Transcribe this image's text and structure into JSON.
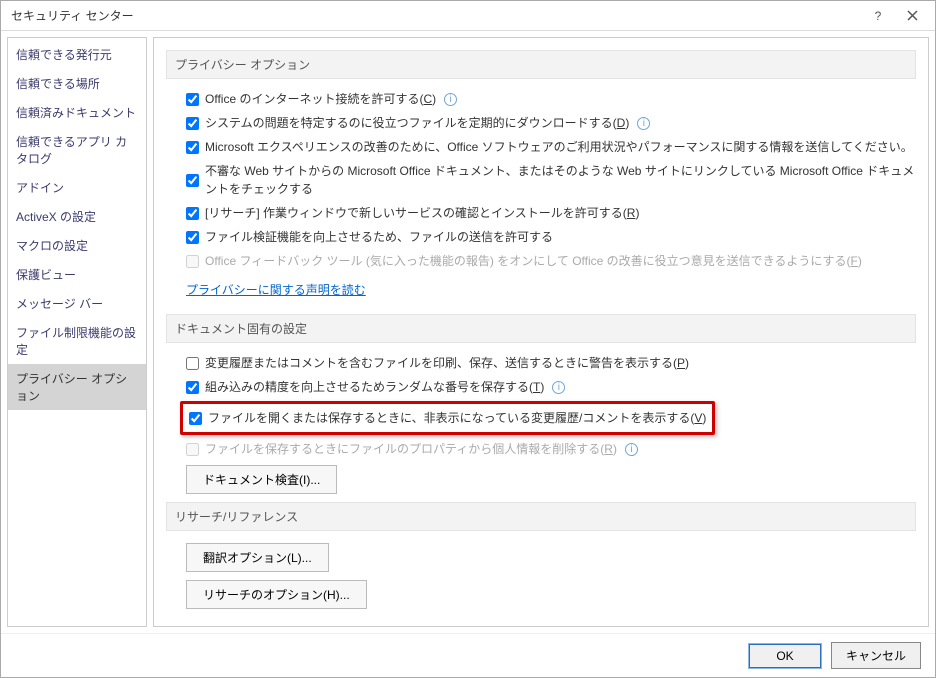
{
  "window": {
    "title": "セキュリティ センター"
  },
  "sidebar": {
    "items": [
      {
        "label": "信頼できる発行元"
      },
      {
        "label": "信頼できる場所"
      },
      {
        "label": "信頼済みドキュメント"
      },
      {
        "label": "信頼できるアプリ カタログ"
      },
      {
        "label": "アドイン"
      },
      {
        "label": "ActiveX の設定"
      },
      {
        "label": "マクロの設定"
      },
      {
        "label": "保護ビュー"
      },
      {
        "label": "メッセージ バー"
      },
      {
        "label": "ファイル制限機能の設定"
      },
      {
        "label": "プライバシー オプション"
      }
    ],
    "selected_index": 10
  },
  "sections": {
    "privacy": "プライバシー オプション",
    "doc": "ドキュメント固有の設定",
    "research": "リサーチ/リファレンス"
  },
  "privacy_opts": {
    "opt1": "Office のインターネット接続を許可する(",
    "opt1_hot": "C",
    "opt2": "システムの問題を特定するのに役立つファイルを定期的にダウンロードする(",
    "opt2_hot": "D",
    "opt3": "Microsoft エクスペリエンスの改善のために、Office ソフトウェアのご利用状況やパフォーマンスに関する情報を送信してください。",
    "opt4": "不審な Web サイトからの Microsoft Office ドキュメント、またはそのような Web サイトにリンクしている Microsoft Office ドキュメントをチェックする",
    "opt5": "[リサーチ] 作業ウィンドウで新しいサービスの確認とインストールを許可する(",
    "opt5_hot": "R",
    "opt6": "ファイル検証機能を向上させるため、ファイルの送信を許可する",
    "opt7a": "Office フィードバック ツール (気に入った機能の報告) をオンにして Office の改善に役立つ意見を送信できるようにする(",
    "opt7_hot": "F",
    "privacy_link": "プライバシーに関する声明を読む"
  },
  "doc_opts": {
    "d1": "変更履歴またはコメントを含むファイルを印刷、保存、送信するときに警告を表示する(",
    "d1_hot": "P",
    "d2": "組み込みの精度を向上させるためランダムな番号を保存する(",
    "d2_hot": "T",
    "d3": "ファイルを開くまたは保存するときに、非表示になっている変更履歴/コメントを表示する(",
    "d3_hot": "V",
    "d4": "ファイルを保存するときにファイルのプロパティから個人情報を削除する(",
    "d4_hot": "R",
    "inspect_btn": "ドキュメント検査(I)..."
  },
  "research_opts": {
    "trans_btn": "翻訳オプション(L)...",
    "research_btn": "リサーチのオプション(H)..."
  },
  "footer": {
    "ok": "OK",
    "cancel": "キャンセル"
  },
  "close_paren": ")"
}
